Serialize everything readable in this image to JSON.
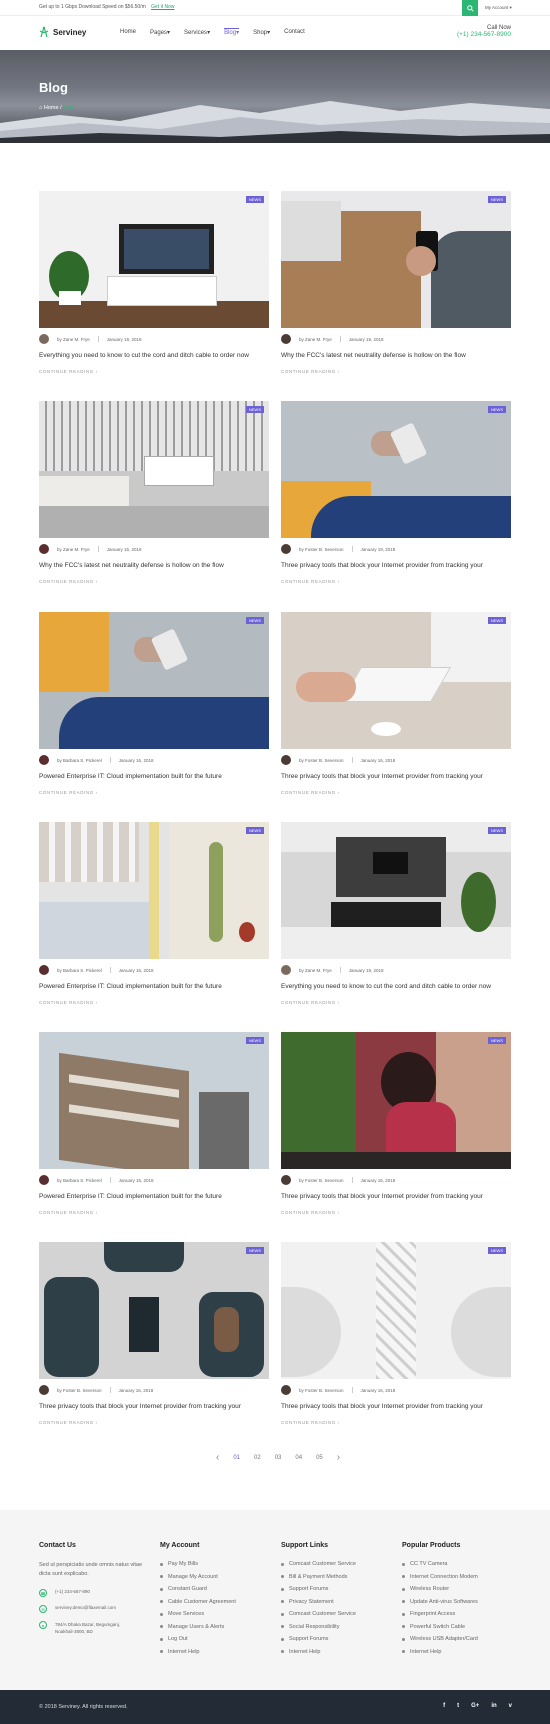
{
  "topbar": {
    "promo": "Get up to 1 Gbps Download Speed on $56.50/m",
    "promo_link": "Get it Now",
    "account": "My Account"
  },
  "brand": {
    "name": "Serviney"
  },
  "nav": {
    "items": [
      "Home",
      "Pages",
      "Services",
      "Blog",
      "Shop",
      "Contact"
    ],
    "active": "Blog"
  },
  "call": {
    "label": "Call Now",
    "number": "(+1) 234-567-8900"
  },
  "hero": {
    "title": "Blog",
    "crumb_home": "Home",
    "crumb_current": "Blog"
  },
  "posts": [
    {
      "badge": "NEWS",
      "author": "by Zane M. Frye",
      "date": "January 19, 2018",
      "title": "Everything you need to know to cut the cord and ditch cable to order now",
      "more": "CONTINUE READING"
    },
    {
      "badge": "NEWS",
      "author": "by Zane M. Frye",
      "date": "January 19, 2018",
      "title": "Why the FCC's latest net neutrality defense is hollow on the flow",
      "more": "CONTINUE READING"
    },
    {
      "badge": "NEWS",
      "author": "by Zane M. Frye",
      "date": "January 15, 2018",
      "title": "Why the FCC's latest net neutrality defense is hollow on the flow",
      "more": "CONTINUE READING"
    },
    {
      "badge": "NEWS",
      "author": "by Foster B. Severson",
      "date": "January 19, 2018",
      "title": "Three privacy tools that block your Internet provider from tracking your",
      "more": "CONTINUE READING"
    },
    {
      "badge": "NEWS",
      "author": "by Barbara S. Pickerel",
      "date": "January 16, 2018",
      "title": "Powered Enterprise IT: Cloud implementation built for the future",
      "more": "CONTINUE READING"
    },
    {
      "badge": "NEWS",
      "author": "by Foster B. Severson",
      "date": "January 16, 2018",
      "title": "Three privacy tools that block your Internet provider from tracking your",
      "more": "CONTINUE READING"
    },
    {
      "badge": "NEWS",
      "author": "by Barbara S. Pickerel",
      "date": "January 16, 2018",
      "title": "Powered Enterprise IT: Cloud implementation built for the future",
      "more": "CONTINUE READING"
    },
    {
      "badge": "NEWS",
      "author": "by Zane M. Frye",
      "date": "January 19, 2018",
      "title": "Everything you need to know to cut the cord and ditch cable to order now",
      "more": "CONTINUE READING"
    },
    {
      "badge": "NEWS",
      "author": "by Barbara S. Pickerel",
      "date": "January 16, 2018",
      "title": "Powered Enterprise IT: Cloud implementation built for the future",
      "more": "CONTINUE READING"
    },
    {
      "badge": "NEWS",
      "author": "by Foster B. Severson",
      "date": "January 16, 2018",
      "title": "Three privacy tools that block your Internet provider from tracking your",
      "more": "CONTINUE READING"
    },
    {
      "badge": "NEWS",
      "author": "by Foster B. Severson",
      "date": "January 16, 2018",
      "title": "Three privacy tools that block your Internet provider from tracking your",
      "more": "CONTINUE READING"
    },
    {
      "badge": "NEWS",
      "author": "by Foster B. Severson",
      "date": "January 16, 2018",
      "title": "Three privacy tools that block your Internet provider from tracking your",
      "more": "CONTINUE READING"
    }
  ],
  "pagination": {
    "pages": [
      "01",
      "02",
      "03",
      "04",
      "05"
    ],
    "active": "01"
  },
  "footer": {
    "contact": {
      "title": "Contact Us",
      "text": "Sed ut perspiciatis unde omnis natus vitae dicta sunt explicabo.",
      "phone": "(+1) 234-567-890",
      "email": "serviney.demo@flaxemail.com",
      "address": "784/A Dhaka Bazar, Begumganj, Noakhali-3800, BD"
    },
    "account": {
      "title": "My Account",
      "links": [
        "Pay My Bills",
        "Manage My Account",
        "Constant Guard",
        "Cable Customer Agreement",
        "Move Services",
        "Manage Users & Alerts",
        "Log Out",
        "Internet Help"
      ]
    },
    "support": {
      "title": "Support Links",
      "links": [
        "Comcast Customer Service",
        "Bill & Payment Methods",
        "Support Forums",
        "Privacy Statement",
        "Comcast Customer Service",
        "Social Responsibility",
        "Support Forums",
        "Internet Help"
      ]
    },
    "products": {
      "title": "Popular Products",
      "links": [
        "CC TV Camera",
        "Internet Connection Modem",
        "Wireless Router",
        "Update Anti-virus Softwares",
        "Fingerprint Access",
        "Powerful Switch Cable",
        "Wireless USB Adapter/Card",
        "Internet Help"
      ]
    },
    "copyright": "© 2018 Serviney. All rights reserved.",
    "social": [
      "f",
      "t",
      "G+",
      "in",
      "v"
    ]
  }
}
